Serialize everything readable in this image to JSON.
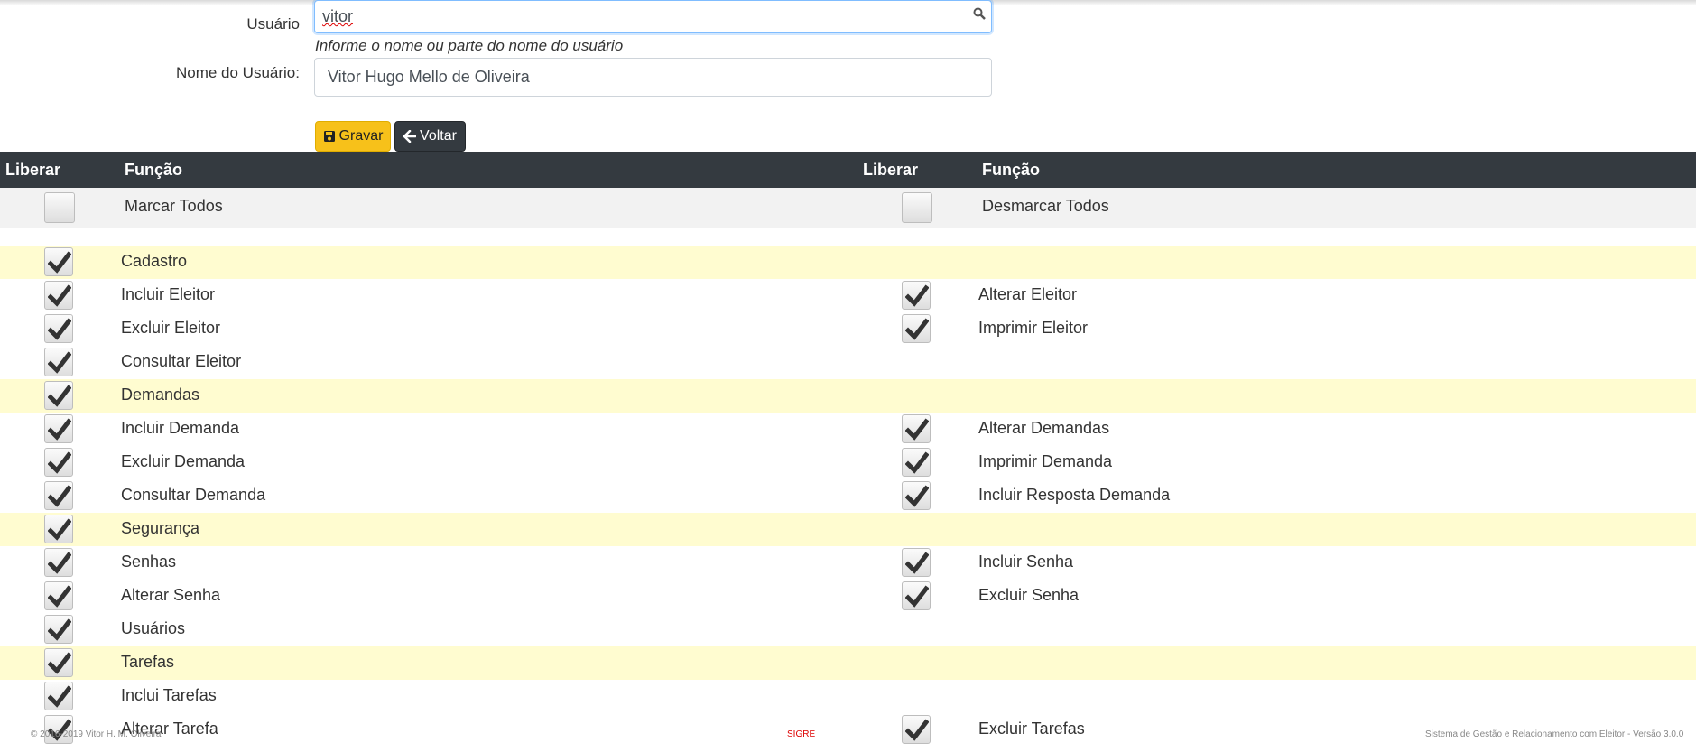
{
  "form": {
    "usuario_label": "Usuário",
    "usuario_value": "vitor",
    "usuario_hint": "Informe o nome ou parte do nome do usuário",
    "nome_label": "Nome do Usuário:",
    "nome_value": "Vitor Hugo Mello de Oliveira"
  },
  "buttons": {
    "gravar": "Gravar",
    "voltar": "Voltar"
  },
  "table": {
    "headers": [
      "Liberar",
      "Função",
      "Liberar",
      "Função"
    ],
    "select_all": "Marcar Todos",
    "deselect_all": "Desmarcar Todos",
    "rows": [
      {
        "group": true,
        "left": "Cadastro",
        "left_checked": true
      },
      {
        "group": false,
        "left": "Incluir Eleitor",
        "left_checked": true,
        "right": "Alterar Eleitor",
        "right_checked": true
      },
      {
        "group": false,
        "left": "Excluir Eleitor",
        "left_checked": true,
        "right": "Imprimir Eleitor",
        "right_checked": true
      },
      {
        "group": false,
        "left": "Consultar Eleitor",
        "left_checked": true
      },
      {
        "group": true,
        "left": "Demandas",
        "left_checked": true
      },
      {
        "group": false,
        "left": "Incluir Demanda",
        "left_checked": true,
        "right": "Alterar Demandas",
        "right_checked": true
      },
      {
        "group": false,
        "left": "Excluir Demanda",
        "left_checked": true,
        "right": "Imprimir Demanda",
        "right_checked": true
      },
      {
        "group": false,
        "left": "Consultar Demanda",
        "left_checked": true,
        "right": "Incluir Resposta Demanda",
        "right_checked": true
      },
      {
        "group": true,
        "left": "Segurança",
        "left_checked": true
      },
      {
        "group": false,
        "left": "Senhas",
        "left_checked": true,
        "right": "Incluir Senha",
        "right_checked": true
      },
      {
        "group": false,
        "left": "Alterar Senha",
        "left_checked": true,
        "right": "Excluir Senha",
        "right_checked": true
      },
      {
        "group": false,
        "left": "Usuários",
        "left_checked": true
      },
      {
        "group": true,
        "left": "Tarefas",
        "left_checked": true
      },
      {
        "group": false,
        "left": "Inclui Tarefas",
        "left_checked": true
      },
      {
        "group": false,
        "left": "Alterar Tarefa",
        "left_checked": true,
        "right": "Excluir Tarefas",
        "right_checked": true
      }
    ]
  },
  "footer": {
    "copyright": "© 2016-2019 Vitor H. M. Oliveira",
    "center": "SIGRE",
    "right": "Sistema de Gestão e Relacionamento com Eleitor - Versão 3.0.0"
  },
  "colors": {
    "accent": "#f7c11a",
    "header_bg": "#343a40",
    "group_row": "#fffcd0"
  },
  "icons": {
    "search": "search-icon",
    "save": "floppy-icon",
    "back": "arrow-left-icon",
    "check": "check-icon"
  }
}
